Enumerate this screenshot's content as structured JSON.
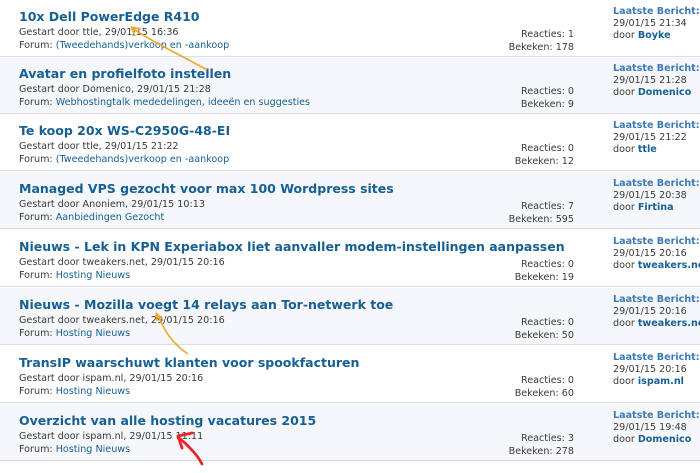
{
  "labels": {
    "started_prefix": "Gestart door",
    "forum_label": "Forum:",
    "replies_label": "Reacties:",
    "views_label": "Bekeken:",
    "last_post_title": "Laatste Bericht:",
    "by_prefix": "door"
  },
  "annotation_colors": {
    "arrow_orange": "#f0a92a",
    "arrow_red": "#e8262a"
  },
  "threads": [
    {
      "title": "10x Dell PowerEdge R410",
      "started": "Gestart door ttle, 29/01/15 16:36",
      "forum": "(Tweedehands)verkoop en -aankoop",
      "replies": "Reacties: 1",
      "views": "Bekeken: 178",
      "last_date": "29/01/15 21:34",
      "last_user": "Boyke"
    },
    {
      "title": "Avatar en profielfoto instellen",
      "started": "Gestart door Domenico, 29/01/15 21:28",
      "forum": "Webhostingtalk mededelingen, ideeën en suggesties",
      "replies": "Reacties: 0",
      "views": "Bekeken: 9",
      "last_date": "29/01/15 21:28",
      "last_user": "Domenico"
    },
    {
      "title": "Te koop 20x WS-C2950G-48-EI",
      "started": "Gestart door ttle, 29/01/15 21:22",
      "forum": "(Tweedehands)verkoop en -aankoop",
      "replies": "Reacties: 0",
      "views": "Bekeken: 12",
      "last_date": "29/01/15 21:22",
      "last_user": "ttle"
    },
    {
      "title": "Managed VPS gezocht voor max 100 Wordpress sites",
      "started": "Gestart door Anoniem, 29/01/15 10:13",
      "forum": "Aanbiedingen Gezocht",
      "replies": "Reacties: 7",
      "views": "Bekeken: 595",
      "last_date": "29/01/15 20:38",
      "last_user": "Firtina"
    },
    {
      "title": "Nieuws - Lek in KPN Experiabox liet aanvaller modem-instellingen aanpassen",
      "started": "Gestart door tweakers.net, 29/01/15 20:16",
      "forum": "Hosting Nieuws",
      "replies": "Reacties: 0",
      "views": "Bekeken: 19",
      "last_date": "29/01/15 20:16",
      "last_user": "tweakers.net"
    },
    {
      "title": "Nieuws - Mozilla voegt 14 relays aan Tor-netwerk toe",
      "started": "Gestart door tweakers.net, 29/01/15 20:16",
      "forum": "Hosting Nieuws",
      "replies": "Reacties: 0",
      "views": "Bekeken: 50",
      "last_date": "29/01/15 20:16",
      "last_user": "tweakers.net"
    },
    {
      "title": "TransIP waarschuwt klanten voor spookfacturen",
      "started": "Gestart door ispam.nl, 29/01/15 20:16",
      "forum": "Hosting Nieuws",
      "replies": "Reacties: 0",
      "views": "Bekeken: 60",
      "last_date": "29/01/15 20:16",
      "last_user": "ispam.nl"
    },
    {
      "title": "Overzicht van alle hosting vacatures 2015",
      "started": "Gestart door ispam.nl, 29/01/15 11:11",
      "forum": "Hosting Nieuws",
      "replies": "Reacties: 3",
      "views": "Bekeken: 278",
      "last_date": "29/01/15 19:48",
      "last_user": "Domenico"
    }
  ]
}
